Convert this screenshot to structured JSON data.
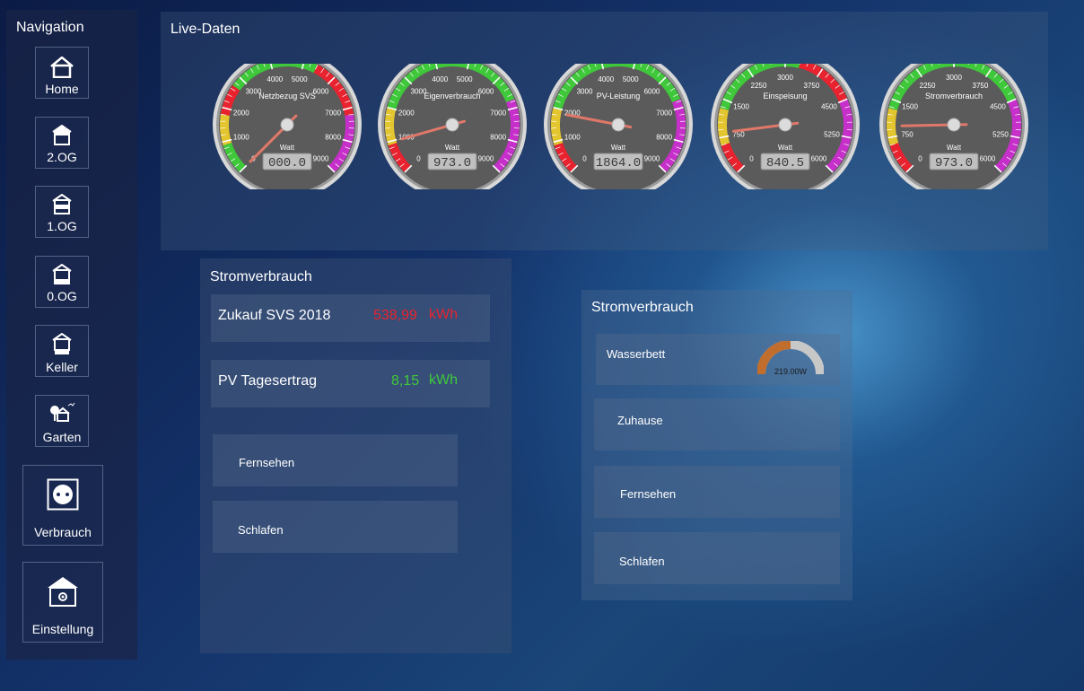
{
  "nav": {
    "title": "Navigation",
    "items": [
      {
        "label": "Home"
      },
      {
        "label": "2.OG"
      },
      {
        "label": "1.OG"
      },
      {
        "label": "0.OG"
      },
      {
        "label": "Keller"
      },
      {
        "label": "Garten"
      },
      {
        "label": "Verbrauch"
      },
      {
        "label": "Einstellung"
      }
    ]
  },
  "live": {
    "title": "Live-Daten",
    "gauges": [
      {
        "title": "Netzbezug SVS",
        "unit": "Watt",
        "display": "000.0",
        "value": 0,
        "max": 9000,
        "ticks": [
          "0",
          "1000",
          "2000",
          "3000",
          "4000",
          "5000",
          "6000",
          "7000",
          "8000",
          "9000"
        ]
      },
      {
        "title": "Eigenverbrauch",
        "unit": "Watt",
        "display": "973.0",
        "value": 973,
        "max": 9000,
        "ticks": [
          "0",
          "1000",
          "2000",
          "3000",
          "4000",
          "5000",
          "6000",
          "7000",
          "8000",
          "9000"
        ]
      },
      {
        "title": "PV-Leistung",
        "unit": "Watt",
        "display": "1864.0",
        "value": 1864,
        "max": 9000,
        "ticks": [
          "0",
          "1000",
          "2000",
          "3000",
          "4000",
          "5000",
          "6000",
          "7000",
          "8000",
          "9000"
        ]
      },
      {
        "title": "Einspeisung",
        "unit": "Watt",
        "display": "840.5",
        "value": 840.5,
        "max": 6000,
        "ticks": [
          "0",
          "750",
          "1500",
          "2250",
          "3000",
          "3750",
          "4500",
          "5250",
          "6000"
        ]
      },
      {
        "title": "Stromverbrauch",
        "unit": "Watt",
        "display": "973.0",
        "value": 973,
        "max": 6000,
        "ticks": [
          "0",
          "750",
          "1500",
          "2250",
          "3000",
          "3750",
          "4500",
          "5250",
          "6000"
        ]
      }
    ]
  },
  "stromverbrauch_left": {
    "title": "Stromverbrauch",
    "zukauf": {
      "label": "Zukauf SVS 2018",
      "value": "538,99",
      "unit": "kWh"
    },
    "pv": {
      "label": "PV Tagesertrag",
      "value": "8,15",
      "unit": "kWh"
    },
    "buttons": [
      "Fernsehen",
      "Schlafen"
    ]
  },
  "stromverbrauch_right": {
    "title": "Stromverbrauch",
    "wasserbett": {
      "label": "Wasserbett",
      "display": "219.00W",
      "fraction": 0.5
    },
    "buttons": [
      "Zuhause",
      "Fernsehen",
      "Schlafen"
    ]
  },
  "colors": {
    "red": "#e8232f",
    "green": "#3ec83a",
    "yellow": "#e3c52f",
    "magenta": "#c62fc9",
    "orange": "#c06d2e"
  }
}
